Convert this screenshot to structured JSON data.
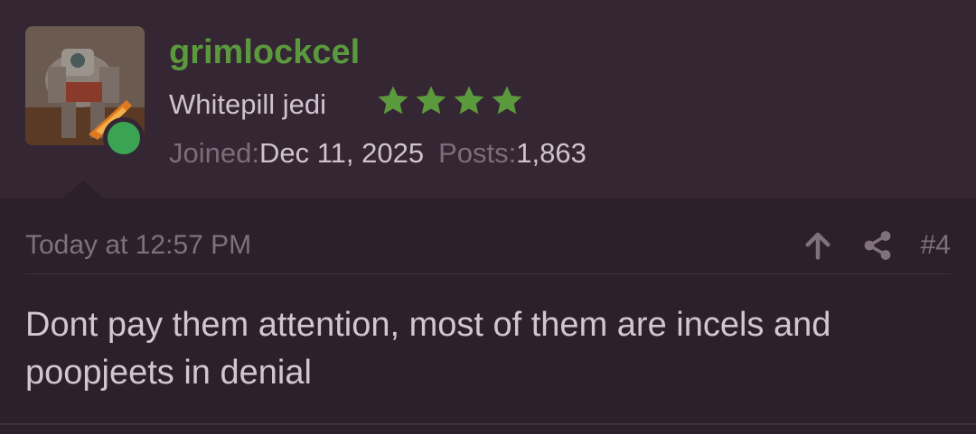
{
  "user": {
    "avatar_icon": "robot-avatar",
    "online_status_icon": "online-dot-icon",
    "username": "grimlockcel",
    "username_color": "#5b9a3c",
    "title": "Whitepill jedi",
    "rating_stars": 4,
    "star_icon": "star-icon",
    "star_color": "#5b9a3c",
    "joined_label": "Joined:",
    "joined_value": "Dec 11, 2025",
    "posts_label": "Posts:",
    "posts_value": "1,863"
  },
  "post": {
    "timestamp": "Today at 12:57 PM",
    "upvote_icon": "arrow-up-icon",
    "share_icon": "share-icon",
    "post_number": "#4",
    "body": "Dont pay them attention, most of them are incels and poopjeets in denial"
  }
}
